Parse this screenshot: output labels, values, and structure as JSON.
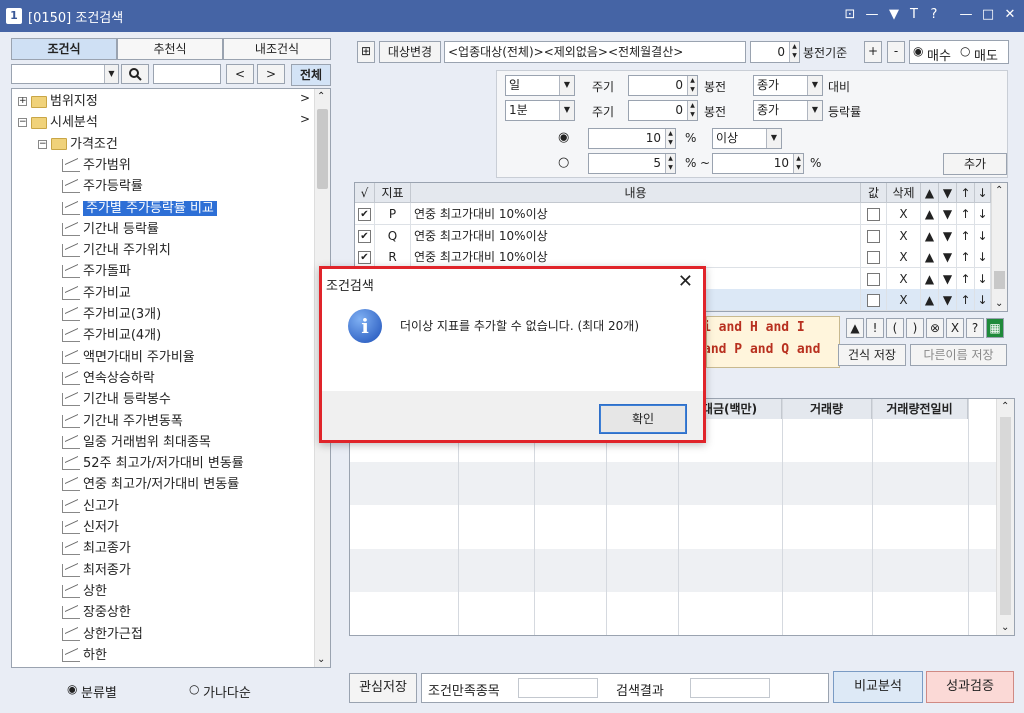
{
  "window": {
    "badge": "1",
    "title": "[0150] 조건검색",
    "controls": [
      "⊡",
      "—",
      "▼",
      "T",
      "?",
      "—",
      "□",
      "✕"
    ]
  },
  "left": {
    "tabs": [
      "조건식",
      "추천식",
      "내조건식"
    ],
    "search": {
      "combo_value": "",
      "text_value": "",
      "prev": "<",
      "next": ">",
      "all_label": "전체"
    },
    "tree": [
      {
        "label": "범위지정",
        "level": 0,
        "type": "folder",
        "expander": "+",
        "arrow": ">"
      },
      {
        "label": "시세분석",
        "level": 0,
        "type": "folder",
        "expander": "−",
        "arrow": ">"
      },
      {
        "label": "가격조건",
        "level": 1,
        "type": "folder",
        "expander": "−"
      },
      {
        "label": "주가범위",
        "level": 2,
        "type": "item"
      },
      {
        "label": "주가등락률",
        "level": 2,
        "type": "item"
      },
      {
        "label": "주가별 주가등락률 비교",
        "level": 2,
        "type": "item",
        "selected": true
      },
      {
        "label": "기간내 등락률",
        "level": 2,
        "type": "item"
      },
      {
        "label": "기간내 주가위치",
        "level": 2,
        "type": "item"
      },
      {
        "label": "주가돌파",
        "level": 2,
        "type": "item"
      },
      {
        "label": "주가비교",
        "level": 2,
        "type": "item"
      },
      {
        "label": "주가비교(3개)",
        "level": 2,
        "type": "item"
      },
      {
        "label": "주가비교(4개)",
        "level": 2,
        "type": "item"
      },
      {
        "label": "액면가대비 주가비율",
        "level": 2,
        "type": "item"
      },
      {
        "label": "연속상승하락",
        "level": 2,
        "type": "item"
      },
      {
        "label": "기간내 등락봉수",
        "level": 2,
        "type": "item"
      },
      {
        "label": "기간내 주가변동폭",
        "level": 2,
        "type": "item"
      },
      {
        "label": "일중 거래범위 최대종목",
        "level": 2,
        "type": "item"
      },
      {
        "label": "52주 최고가/저가대비 변동률",
        "level": 2,
        "type": "item"
      },
      {
        "label": "연중 최고가/저가대비 변동률",
        "level": 2,
        "type": "item"
      },
      {
        "label": "신고가",
        "level": 2,
        "type": "item"
      },
      {
        "label": "신저가",
        "level": 2,
        "type": "item"
      },
      {
        "label": "최고종가",
        "level": 2,
        "type": "item"
      },
      {
        "label": "최저종가",
        "level": 2,
        "type": "item"
      },
      {
        "label": "상한",
        "level": 2,
        "type": "item"
      },
      {
        "label": "장중상한",
        "level": 2,
        "type": "item"
      },
      {
        "label": "상한가근접",
        "level": 2,
        "type": "item"
      },
      {
        "label": "하한",
        "level": 2,
        "type": "item"
      }
    ],
    "radios": {
      "opt1": "분류별",
      "opt2": "가나다순",
      "selected": "분류별"
    }
  },
  "top": {
    "change_target_btn": "대상변경",
    "target_text": "<업종대상(전체)><제외없음><전체월결산>",
    "bong_value": "0",
    "bong_label": "봉전기준",
    "plus": "+",
    "minus": "-",
    "buy_label": "매수",
    "sell_label": "매도",
    "selected": "매수"
  },
  "params": {
    "row1": {
      "period": "일",
      "cycle_label": "주기",
      "value": "0",
      "bong": "봉전",
      "price": "종가",
      "suffix": "대비"
    },
    "row2": {
      "period": "1분",
      "cycle_label": "주기",
      "value": "0",
      "bong": "봉전",
      "price": "종가",
      "suffix": "등락률"
    },
    "row3": {
      "value": "10",
      "pct": "%",
      "cond": "이상"
    },
    "row4": {
      "from": "5",
      "pct": "%",
      "tilde": "~",
      "to": "10",
      "pct2": "%"
    },
    "add_btn": "추가"
  },
  "grid": {
    "headers": {
      "check": "√",
      "index": "지표",
      "content": "내용",
      "value": "값",
      "delete": "삭제",
      "up": "▲",
      "down": "▼",
      "top": "↑",
      "bottom": "↓"
    },
    "rows": [
      {
        "checked": true,
        "index": "P",
        "content": "연중 최고가대비 10%이상",
        "del": "X"
      },
      {
        "checked": true,
        "index": "Q",
        "content": "연중 최고가대비 10%이상",
        "del": "X"
      },
      {
        "checked": true,
        "index": "R",
        "content": "연중 최고가대비 10%이상",
        "del": "X"
      },
      {
        "checked": false,
        "index": "",
        "content": "",
        "del": "X"
      },
      {
        "checked": false,
        "index": "",
        "content": "",
        "del": "X"
      }
    ]
  },
  "logic": {
    "line1": "i and H and I",
    "line2": "and P and Q and",
    "ops": [
      "▲",
      "!",
      "(",
      ")",
      "⊗",
      "X",
      "?",
      "▦"
    ]
  },
  "save": {
    "save_label": "건식 저장",
    "save_as_label": "다른이름 저장"
  },
  "results": {
    "headers": [
      "대금(백만)",
      "거래량",
      "거래량전일비"
    ]
  },
  "bottom": {
    "watch_save": "관심저장",
    "matched_label": "조건만족종목",
    "search_result": "검색결과",
    "compare": "비교분석",
    "verify": "성과검증"
  },
  "dialog": {
    "title": "조건검색",
    "close": "✕",
    "message": "더이상 지표를 추가할 수 없습니다. (최대 20개)",
    "ok": "확인"
  }
}
